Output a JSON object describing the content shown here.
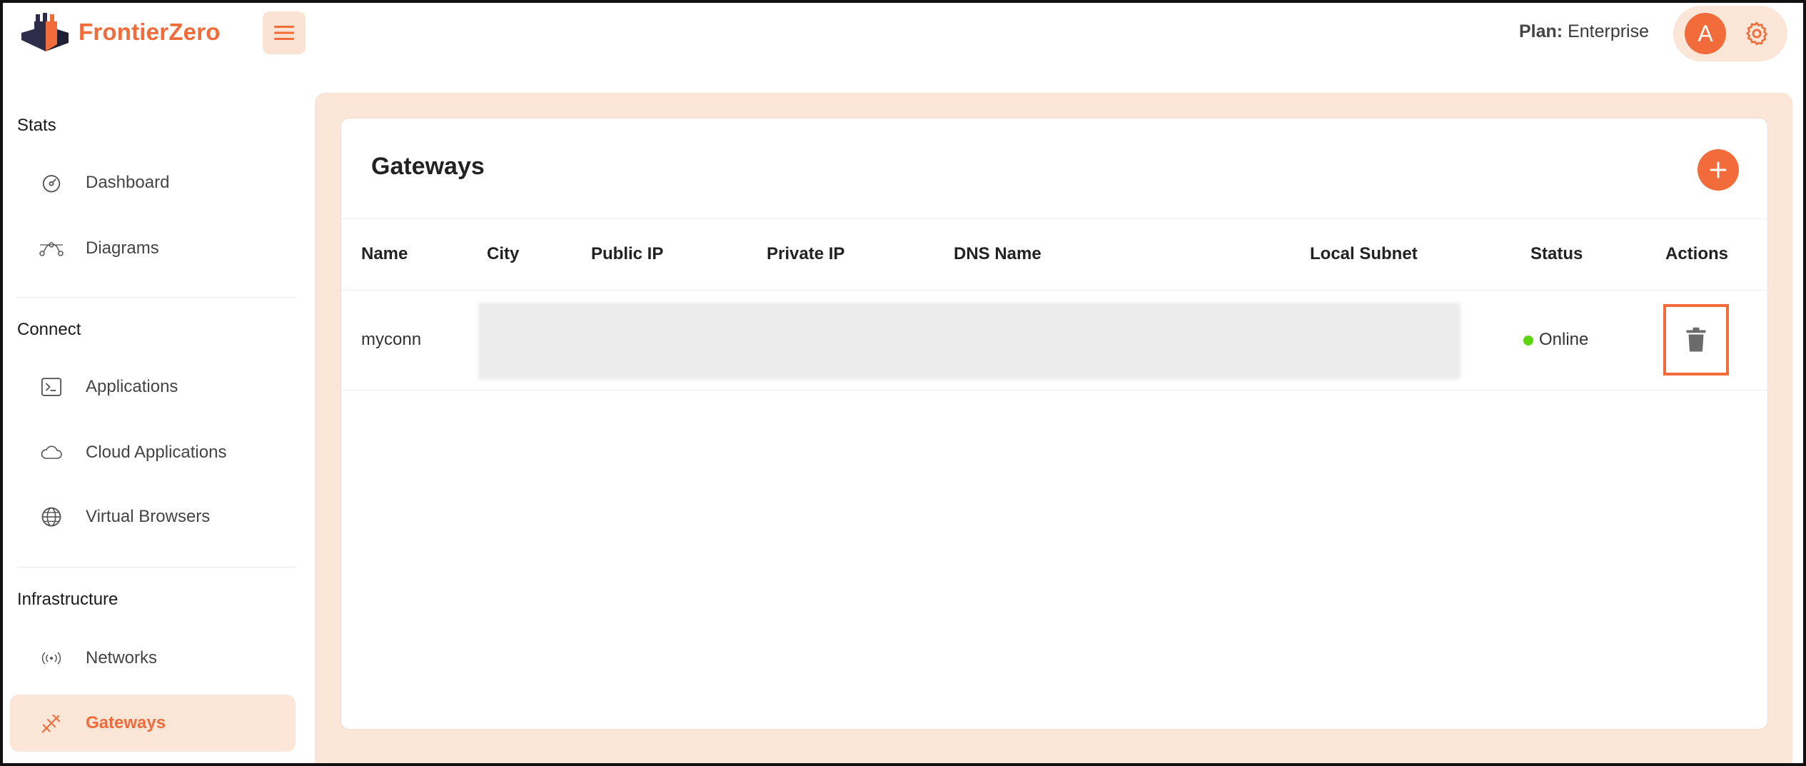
{
  "brand": {
    "name": "FrontierZero",
    "accent": "#f26b3a"
  },
  "header": {
    "plan_label": "Plan:",
    "plan_value": "Enterprise",
    "avatar_letter": "A"
  },
  "sidebar": {
    "sections": [
      {
        "title": "Stats",
        "items": [
          {
            "label": "Dashboard",
            "icon": "gauge-icon"
          },
          {
            "label": "Diagrams",
            "icon": "diagram-icon"
          }
        ]
      },
      {
        "title": "Connect",
        "items": [
          {
            "label": "Applications",
            "icon": "terminal-icon"
          },
          {
            "label": "Cloud Applications",
            "icon": "cloud-icon"
          },
          {
            "label": "Virtual Browsers",
            "icon": "globe-icon"
          }
        ]
      },
      {
        "title": "Infrastructure",
        "items": [
          {
            "label": "Networks",
            "icon": "broadcast-icon"
          },
          {
            "label": "Gateways",
            "icon": "gateway-icon",
            "active": true
          }
        ]
      }
    ]
  },
  "main": {
    "title": "Gateways",
    "table": {
      "columns": [
        "Name",
        "City",
        "Public IP",
        "Private IP",
        "DNS Name",
        "Local Subnet",
        "Status",
        "Actions"
      ],
      "rows": [
        {
          "name": "myconn",
          "status": "Online",
          "status_color": "#5cd60d"
        }
      ]
    }
  }
}
